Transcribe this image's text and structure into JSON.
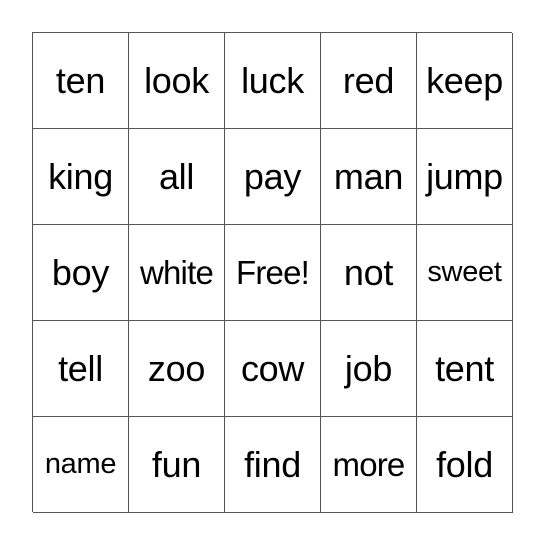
{
  "card": {
    "rows": [
      [
        "ten",
        "look",
        "luck",
        "red",
        "keep"
      ],
      [
        "king",
        "all",
        "pay",
        "man",
        "jump"
      ],
      [
        "boy",
        "white",
        "Free!",
        "not",
        "sweet"
      ],
      [
        "tell",
        "zoo",
        "cow",
        "job",
        "tent"
      ],
      [
        "name",
        "fun",
        "find",
        "more",
        "fold"
      ]
    ]
  },
  "colors": {
    "grid_line": "#555555",
    "text": "#000000",
    "background": "#ffffff"
  }
}
